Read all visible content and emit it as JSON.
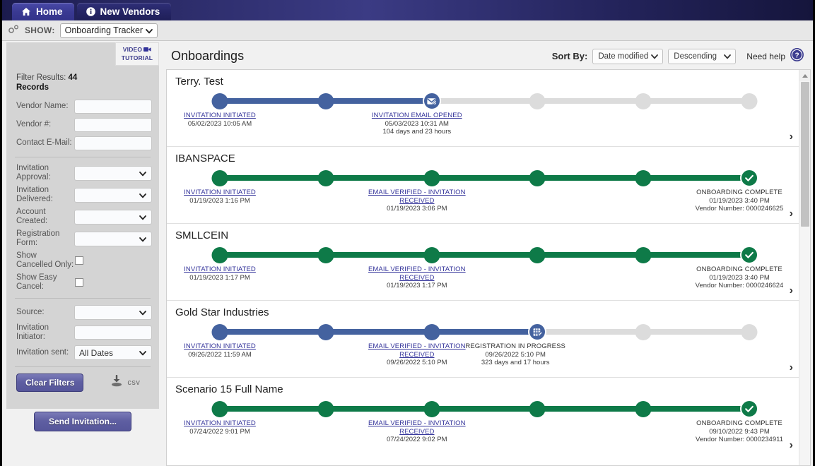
{
  "tabs": [
    {
      "label": "Home",
      "icon": "home-icon",
      "active": true
    },
    {
      "label": "New Vendors",
      "icon": "info-icon",
      "active": false
    }
  ],
  "showbar": {
    "icon": "settings-gear-icon",
    "label": "SHOW:",
    "selected": "Onboarding Tracker"
  },
  "sidebar": {
    "video_tutorial": {
      "line1": "VIDEO",
      "line2": "TUTORIAL",
      "icon": "video-camera-icon"
    },
    "filter_results_label": "Filter Results:",
    "filter_results_count": "44",
    "filter_results_suffix": "Records",
    "fields": [
      {
        "label": "Vendor Name:",
        "type": "text",
        "value": ""
      },
      {
        "label": "Vendor #:",
        "type": "text",
        "value": ""
      },
      {
        "label": "Contact E-Mail:",
        "type": "text",
        "value": ""
      }
    ],
    "selects": [
      {
        "label": "Invitation Approval:",
        "value": ""
      },
      {
        "label": "Invitation Delivered:",
        "value": ""
      },
      {
        "label": "Account Created:",
        "value": ""
      },
      {
        "label": "Registration Form:",
        "value": ""
      }
    ],
    "checkboxes": [
      {
        "label": "Show Cancelled Only:",
        "checked": false
      },
      {
        "label": "Show Easy Cancel:",
        "checked": false
      }
    ],
    "source": {
      "label": "Source:",
      "value": ""
    },
    "initiator": {
      "label": "Invitation Initiator:",
      "value": ""
    },
    "sent": {
      "label": "Invitation sent:",
      "value": "All Dates"
    },
    "clear_filters": "Clear Filters",
    "csv_label": "csv",
    "csv_icon": "download-icon",
    "send_invitation": "Send Invitation..."
  },
  "main": {
    "title": "Onboardings",
    "sort_by_label": "Sort By:",
    "sort_field": "Date modified",
    "sort_direction": "Descending",
    "need_help": "Need help",
    "help_icon": "question-mark-icon",
    "colors": {
      "complete": "#0e7a48",
      "inprogress": "#44629f",
      "pending": "#dcdcdc"
    },
    "records": [
      {
        "name": "Terry. Test",
        "state": "inprogress",
        "nodes": 6,
        "filled": 3,
        "current_icon": "envelope-opened-icon",
        "labels": [
          {
            "pos": 0,
            "title": "INVITATION INITIATED",
            "link": true,
            "datetime": "05/02/2023 10:05 AM",
            "elapsed": ""
          },
          {
            "pos": 2,
            "title": "INVITATION EMAIL OPENED",
            "link": true,
            "datetime": "05/03/2023 10:31 AM",
            "elapsed": "104 days and 23 hours"
          }
        ],
        "right_label": null
      },
      {
        "name": "IBANSPACE",
        "state": "complete",
        "nodes": 6,
        "filled": 6,
        "current_icon": "check-mark-icon",
        "labels": [
          {
            "pos": 0,
            "title": "INVITATION INITIATED",
            "link": true,
            "datetime": "01/19/2023 1:16 PM",
            "elapsed": ""
          },
          {
            "pos": 2,
            "title": "EMAIL VERIFIED - INVITATION RECEIVED",
            "link": true,
            "datetime": "01/19/2023 3:06 PM",
            "elapsed": ""
          }
        ],
        "right_label": {
          "title": "ONBOARDING COMPLETE",
          "datetime": "01/19/2023 3:40 PM",
          "extra": "Vendor Number: 0000246625"
        }
      },
      {
        "name": "SMLLCEIN",
        "state": "complete",
        "nodes": 6,
        "filled": 6,
        "current_icon": "check-mark-icon",
        "labels": [
          {
            "pos": 0,
            "title": "INVITATION INITIATED",
            "link": true,
            "datetime": "01/19/2023 1:17 PM",
            "elapsed": ""
          },
          {
            "pos": 2,
            "title": "EMAIL VERIFIED - INVITATION RECEIVED",
            "link": true,
            "datetime": "01/19/2023 1:17 PM",
            "elapsed": ""
          }
        ],
        "right_label": {
          "title": "ONBOARDING COMPLETE",
          "datetime": "01/19/2023 3:40 PM",
          "extra": "Vendor Number: 0000246624"
        }
      },
      {
        "name": "Gold Star Industries",
        "state": "inprogress",
        "nodes": 6,
        "filled": 4,
        "current_icon": "registration-form-icon",
        "labels": [
          {
            "pos": 0,
            "title": "INVITATION INITIATED",
            "link": true,
            "datetime": "09/26/2022 11:59 AM",
            "elapsed": ""
          },
          {
            "pos": 2,
            "title": "EMAIL VERIFIED - INVITATION RECEIVED",
            "link": true,
            "datetime": "09/26/2022 5:10 PM",
            "elapsed": ""
          },
          {
            "pos": 3,
            "title": "REGISTRATION IN PROGRESS",
            "link": false,
            "datetime": "09/26/2022 5:10 PM",
            "elapsed": "323 days and 17 hours"
          }
        ],
        "right_label": null
      },
      {
        "name": "Scenario 15 Full Name",
        "state": "complete",
        "nodes": 6,
        "filled": 6,
        "current_icon": "check-mark-icon",
        "labels": [
          {
            "pos": 0,
            "title": "INVITATION INITIATED",
            "link": true,
            "datetime": "07/24/2022 9:01 PM",
            "elapsed": ""
          },
          {
            "pos": 2,
            "title": "EMAIL VERIFIED - INVITATION RECEIVED",
            "link": true,
            "datetime": "07/24/2022 9:02 PM",
            "elapsed": ""
          }
        ],
        "right_label": {
          "title": "ONBOARDING COMPLETE",
          "datetime": "09/10/2022 9:43 PM",
          "extra": "Vendor Number: 0000234911"
        }
      }
    ],
    "row_chevron": "›"
  }
}
